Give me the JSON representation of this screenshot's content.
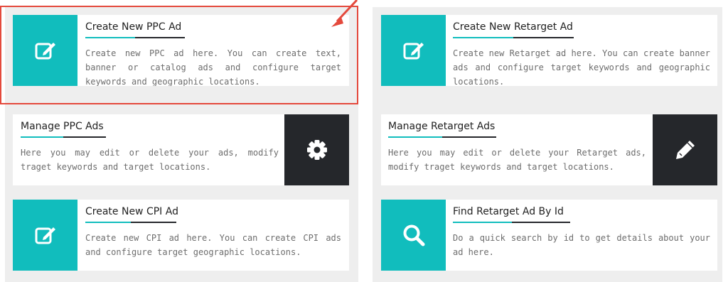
{
  "accent_color": "#11bdbd",
  "dark_color": "#25272b",
  "highlight_color": "#e4493c",
  "cards": {
    "create_ppc": {
      "title": "Create New PPC Ad",
      "desc": "Create new PPC ad here. You can create text, banner or catalog ads and configure target keywords and geographic locations.",
      "icon": "edit-icon"
    },
    "manage_ppc": {
      "title": "Manage PPC Ads",
      "desc": "Here you may edit or delete your ads, modify traget keywords and target locations.",
      "icon": "gear-icon"
    },
    "create_cpi": {
      "title": "Create New CPI Ad",
      "desc": "Create new CPI ad here. You can create CPI ads and configure target geographic locations.",
      "icon": "edit-icon"
    },
    "create_retarget": {
      "title": "Create New Retarget Ad",
      "desc": "Create new Retarget ad here. You can create banner ads and configure target keywords and geographic locations.",
      "icon": "edit-icon"
    },
    "manage_retarget": {
      "title": "Manage Retarget Ads",
      "desc": "Here you may edit or delete your Retarget ads, modify traget keywords and target locations.",
      "icon": "pencil-icon"
    },
    "find_retarget": {
      "title": "Find Retarget Ad By Id",
      "desc": "Do a quick search by id to get details about your ad here.",
      "icon": "search-icon"
    }
  }
}
